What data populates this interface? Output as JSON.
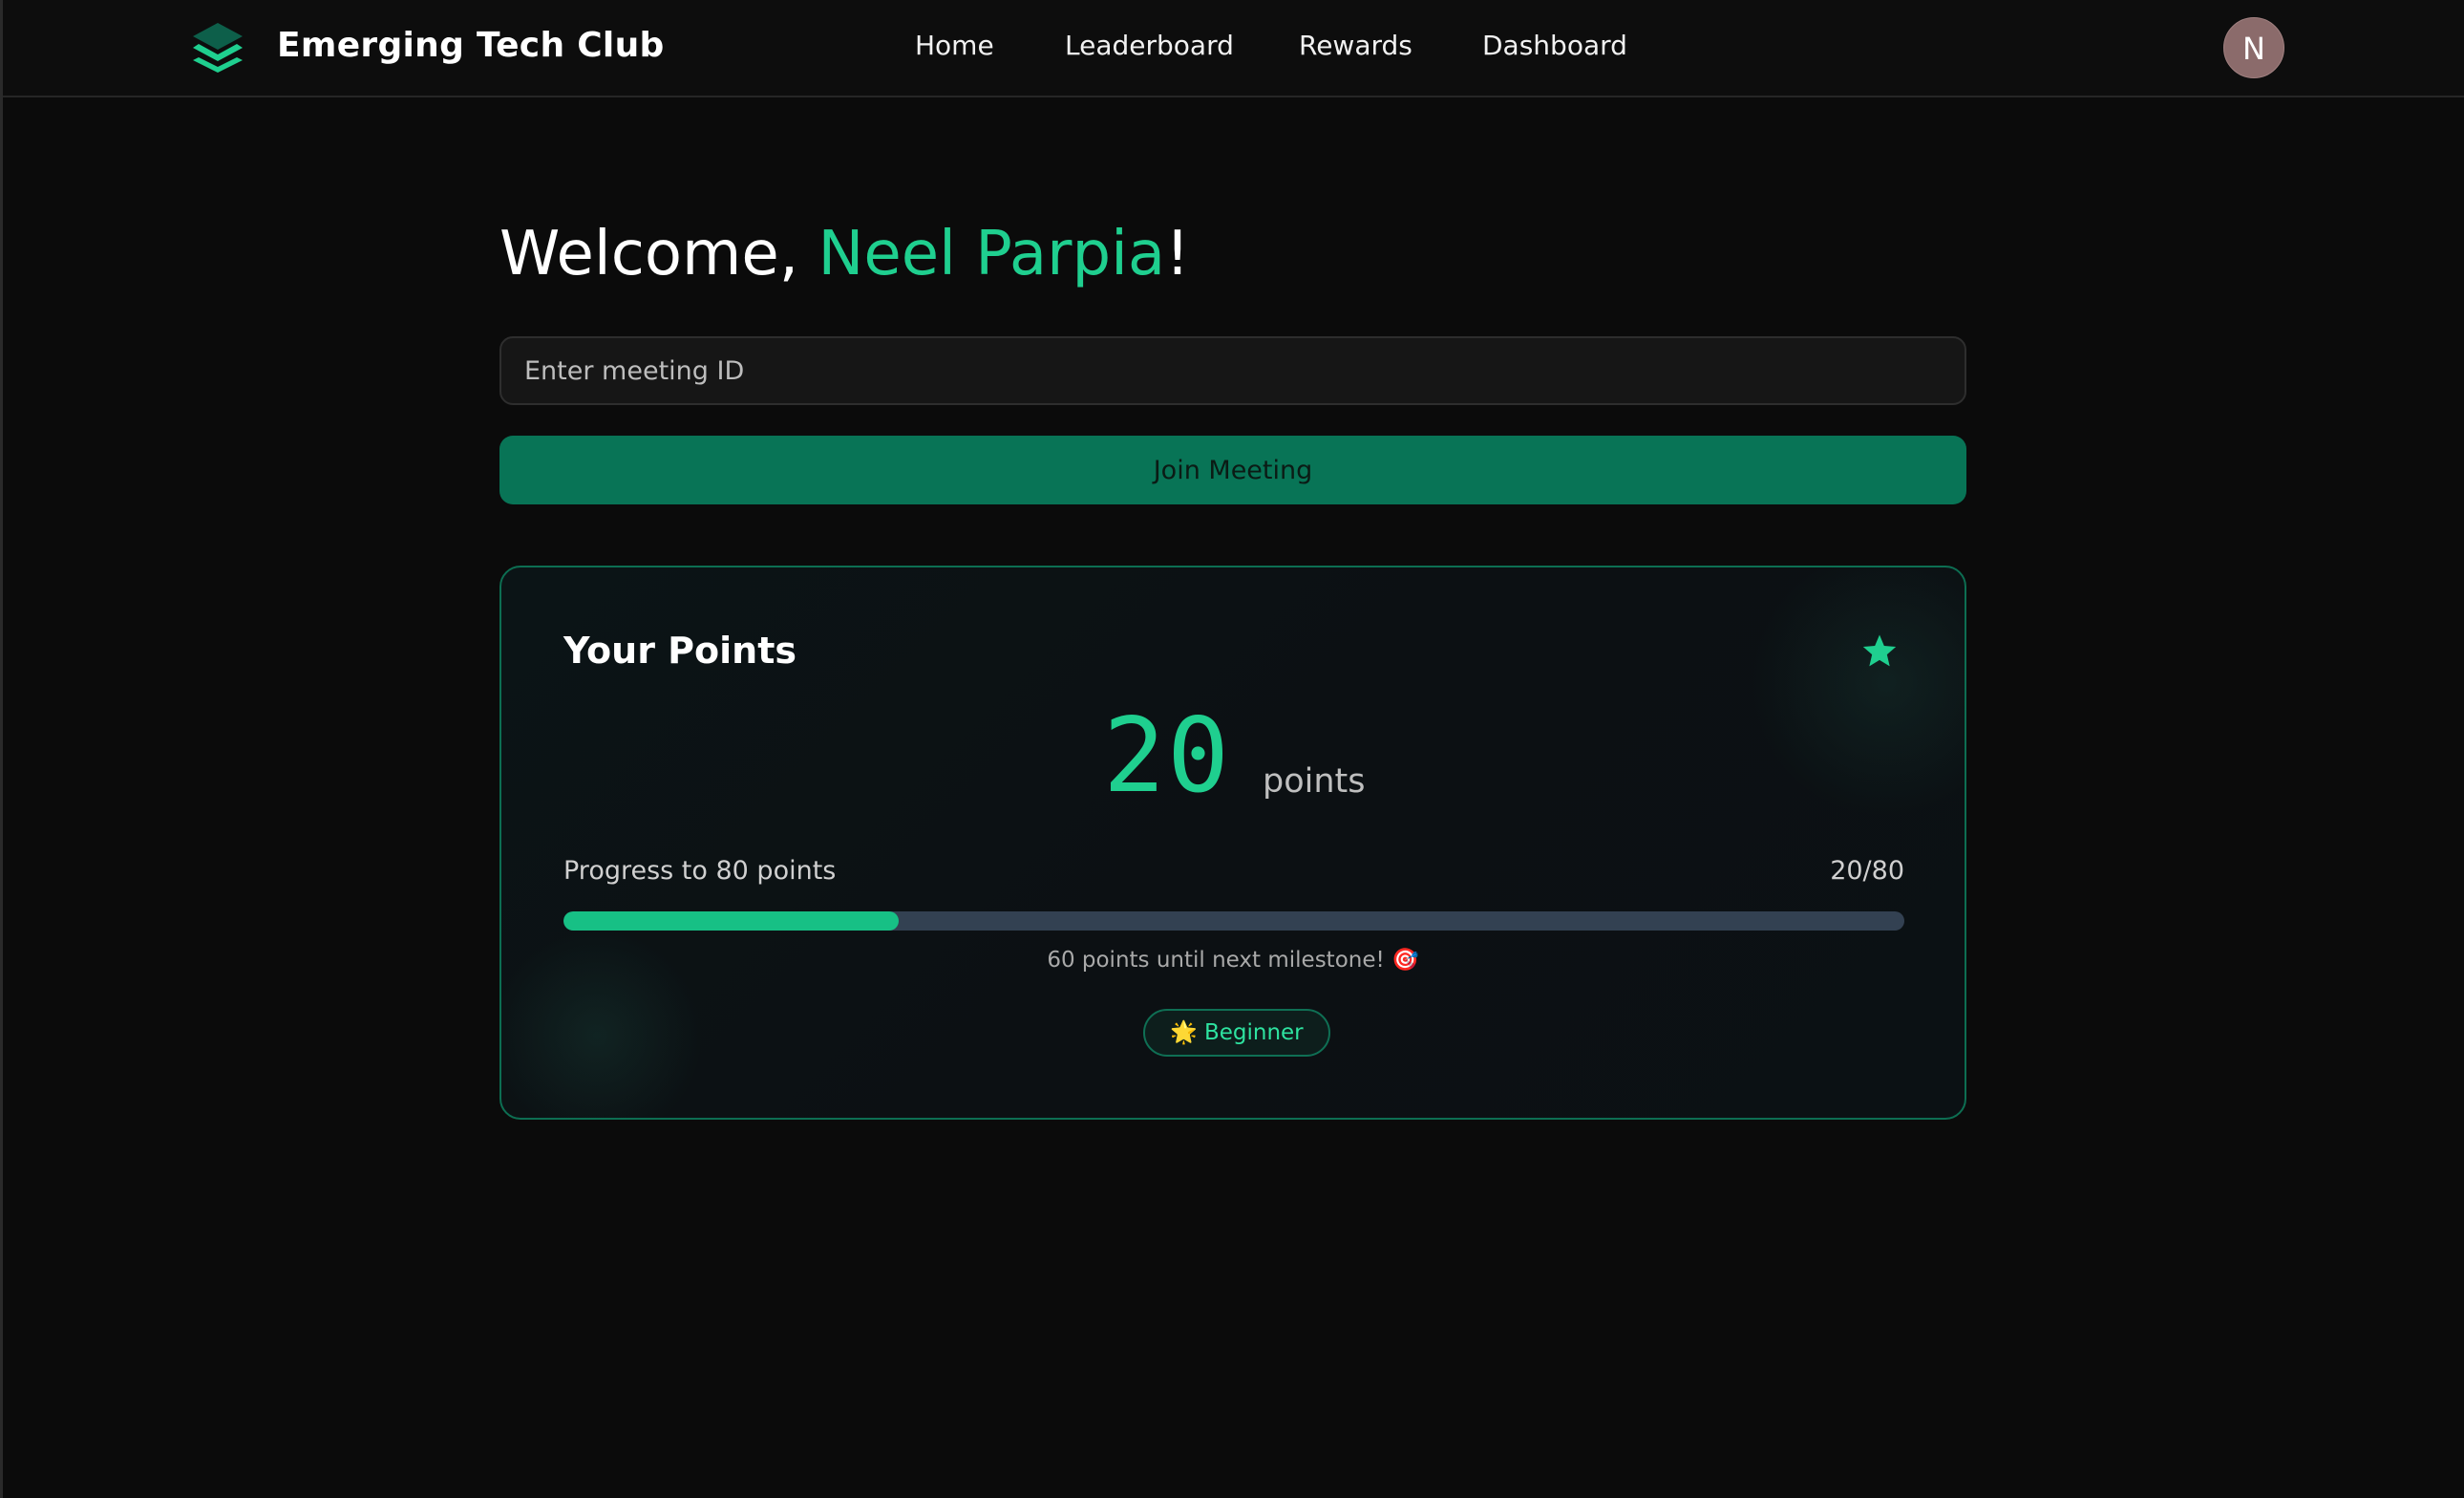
{
  "navbar": {
    "brand": "Emerging Tech Club",
    "links": [
      "Home",
      "Leaderboard",
      "Rewards",
      "Dashboard"
    ],
    "avatar_initial": "N"
  },
  "welcome": {
    "prefix": "Welcome, ",
    "name": "Neel Parpia",
    "suffix": "!"
  },
  "meeting": {
    "input_placeholder": "Enter meeting ID",
    "input_value": "",
    "join_label": "Join Meeting"
  },
  "points_card": {
    "title": "Your Points",
    "points_value": "20",
    "points_unit": "points",
    "progress_label": "Progress to 80 points",
    "progress_count": "20/80",
    "progress_fraction": 0.25,
    "milestone_text": "60 points until next milestone! 🎯",
    "badge_label": "🌟 Beginner"
  },
  "colors": {
    "accent": "#1fcf8f",
    "button": "#087456",
    "progress_track": "#334152",
    "background": "#0b0b0b"
  },
  "icons": {
    "logo": "stacked-layers-icon",
    "card": "star-icon"
  }
}
